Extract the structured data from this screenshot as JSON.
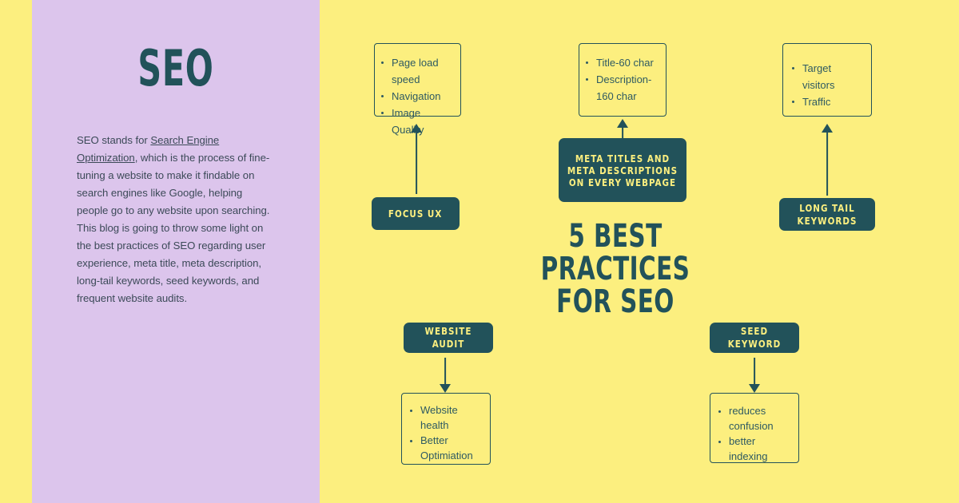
{
  "colors": {
    "background_yellow": "#FCEF7F",
    "panel_lavender": "#DCC5EC",
    "dark_teal": "#22525A",
    "body_text": "#3C4A58"
  },
  "left_panel": {
    "title": "SEO",
    "paragraph_prefix": "SEO stands for ",
    "paragraph_link": "Search Engine Optimization",
    "paragraph_rest": ", which is the process of fine-tuning a website to make it findable on search engines like Google, helping people go to any website upon searching. This blog is going to throw some light on the best practices of SEO regarding user experience, meta title, meta description, long-tail keywords, seed keywords, and frequent website audits."
  },
  "headline": "5 BEST PRACTICES FOR SEO",
  "practices": {
    "focus_ux": {
      "label": "FOCUS UX",
      "items": [
        "Page load speed",
        "Navigation",
        "Image Quality"
      ]
    },
    "meta": {
      "label": "META TITLES AND META DESCRIPTIONS ON EVERY WEBPAGE",
      "items": [
        "Title-60 char",
        "Description-160 char"
      ]
    },
    "long_tail": {
      "label": "LONG TAIL KEYWORDS",
      "items": [
        "Target visitors",
        "Traffic"
      ]
    },
    "website_audit": {
      "label": "WEBSITE AUDIT",
      "items": [
        "Website health",
        "Better Optimiation"
      ]
    },
    "seed_keyword": {
      "label": "SEED KEYWORD",
      "items": [
        "reduces confusion",
        "better indexing"
      ]
    }
  }
}
